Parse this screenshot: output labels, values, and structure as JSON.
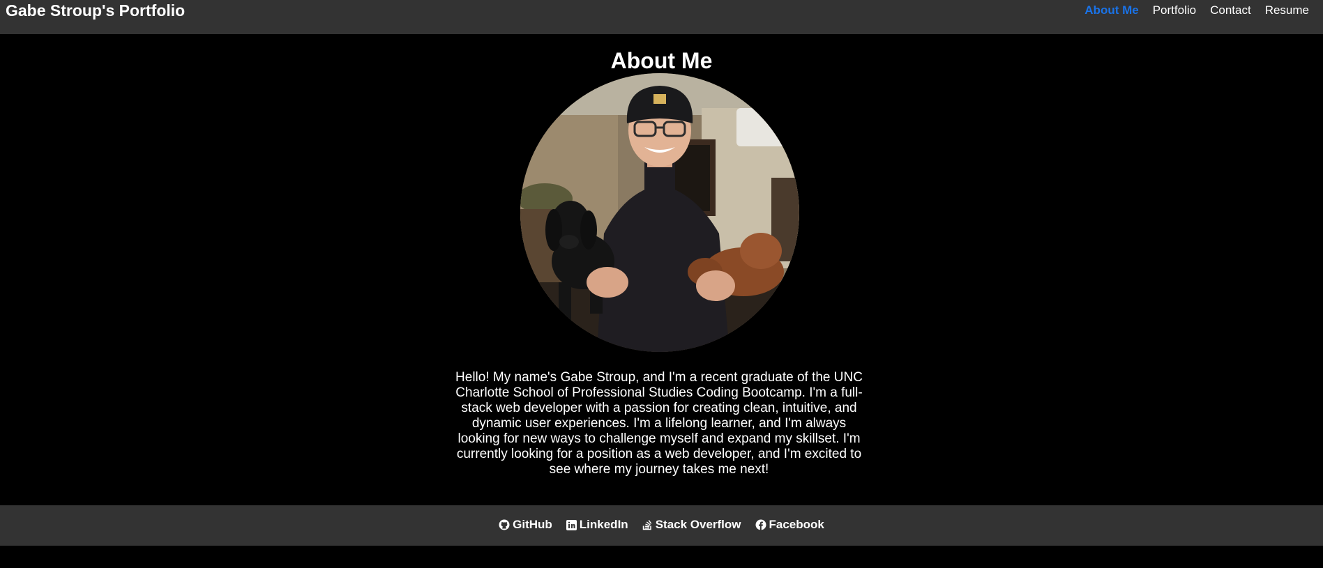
{
  "header": {
    "site_title": "Gabe Stroup's Portfolio",
    "nav": [
      {
        "label": "About Me",
        "active": true
      },
      {
        "label": "Portfolio",
        "active": false
      },
      {
        "label": "Contact",
        "active": false
      },
      {
        "label": "Resume",
        "active": false
      }
    ]
  },
  "main": {
    "title": "About Me",
    "bio": "Hello! My name's Gabe Stroup, and I'm a recent graduate of the UNC Charlotte School of Professional Studies Coding Bootcamp. I'm a full-stack web developer with a passion for creating clean, intuitive, and dynamic user experiences. I'm a lifelong learner, and I'm always looking for new ways to challenge myself and expand my skillset. I'm currently looking for a position as a web developer, and I'm excited to see where my journey takes me next!"
  },
  "footer": {
    "links": [
      {
        "label": "GitHub",
        "icon": "github-icon"
      },
      {
        "label": "LinkedIn",
        "icon": "linkedin-icon"
      },
      {
        "label": "Stack Overflow",
        "icon": "stack-overflow-icon"
      },
      {
        "label": "Facebook",
        "icon": "facebook-icon"
      }
    ]
  },
  "colors": {
    "header_bg": "#333333",
    "page_bg": "#000000",
    "active_nav": "#1a73e8"
  }
}
